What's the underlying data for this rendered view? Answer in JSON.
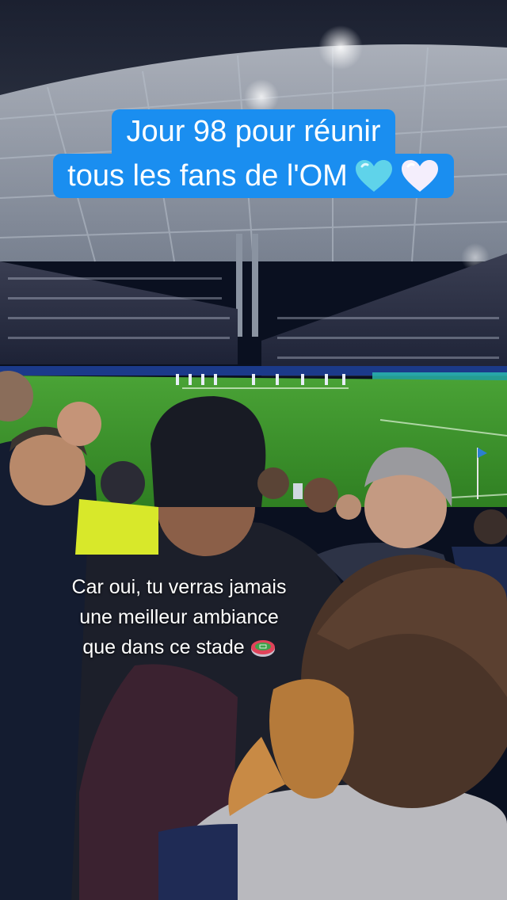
{
  "overlay_top": {
    "line1": "Jour 98 pour réunir",
    "line2": "tous les fans de l'OM",
    "emojis": [
      "light-blue-heart-icon",
      "white-heart-icon"
    ]
  },
  "overlay_bottom": {
    "line1": "Car oui, tu verras jamais",
    "line2": "une meilleur ambiance",
    "line3": "que dans ce stade",
    "emoji": "stadium-icon"
  },
  "colors": {
    "caption_bg": "#1a8ef0",
    "pitch": "#3f9a2c",
    "heart_blue": "#5fd3ea",
    "heart_white": "#f4eefc"
  }
}
